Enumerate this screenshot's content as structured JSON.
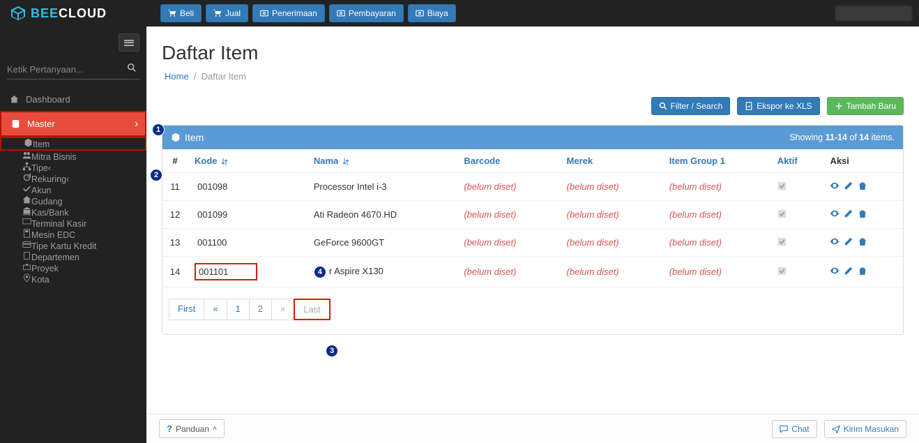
{
  "brand": {
    "part1": "BEE",
    "part2": "CLOUD"
  },
  "topMenu": {
    "beli": "Beli",
    "jual": "Jual",
    "penerimaan": "Penerimaan",
    "pembayaran": "Pembayaran",
    "biaya": "Biaya"
  },
  "searchPlaceholder": "Ketik Pertanyaan...",
  "sidebar": {
    "dashboard": "Dashboard",
    "master": "Master",
    "sub": {
      "item": "Item",
      "mitra": "Mitra Bisnis",
      "tipe": "Tipe",
      "rekuring": "Rekuring",
      "akun": "Akun",
      "gudang": "Gudang",
      "kasbank": "Kas/Bank",
      "terminal": "Terminal Kasir",
      "edc": "Mesin EDC",
      "cc": "Tipe Kartu Kredit",
      "departemen": "Departemen",
      "proyek": "Proyek",
      "kota": "Kota"
    }
  },
  "page": {
    "title": "Daftar Item",
    "breadcrumbHome": "Home",
    "breadcrumbCurrent": "Daftar Item"
  },
  "actions": {
    "filter": "Filter / Search",
    "export": "Ekspor ke XLS",
    "add": "Tambah Baru"
  },
  "panel": {
    "title": "Item",
    "summaryPrefix": "Showing ",
    "summaryRange": "11-14",
    "summaryOf": " of ",
    "summaryTotal": "14",
    "summarySuffix": " items."
  },
  "columns": {
    "idx": "#",
    "kode": "Kode",
    "nama": "Nama",
    "barcode": "Barcode",
    "merek": "Merek",
    "group": "Item Group 1",
    "aktif": "Aktif",
    "aksi": "Aksi"
  },
  "notSet": "(belum diset)",
  "rows": [
    {
      "n": "11",
      "kode": "001098",
      "nama": "Processor Intel i-3"
    },
    {
      "n": "12",
      "kode": "001099",
      "nama": "Ati Radeon 4670 HD"
    },
    {
      "n": "13",
      "kode": "001100",
      "nama": "GeForce 9600GT"
    },
    {
      "n": "14",
      "kode": "001101",
      "nama": "r Aspire X130",
      "highlightKode": true,
      "badge": "4"
    }
  ],
  "pagination": {
    "first": "First",
    "prev": "«",
    "p1": "1",
    "p2": "2",
    "next": "»",
    "last": "Last"
  },
  "footer": {
    "panduan": "Panduan",
    "chat": "Chat",
    "feedback": "Kirim Masukan"
  },
  "badges": {
    "b1": "1",
    "b2": "2",
    "b3": "3",
    "b4": "4"
  }
}
